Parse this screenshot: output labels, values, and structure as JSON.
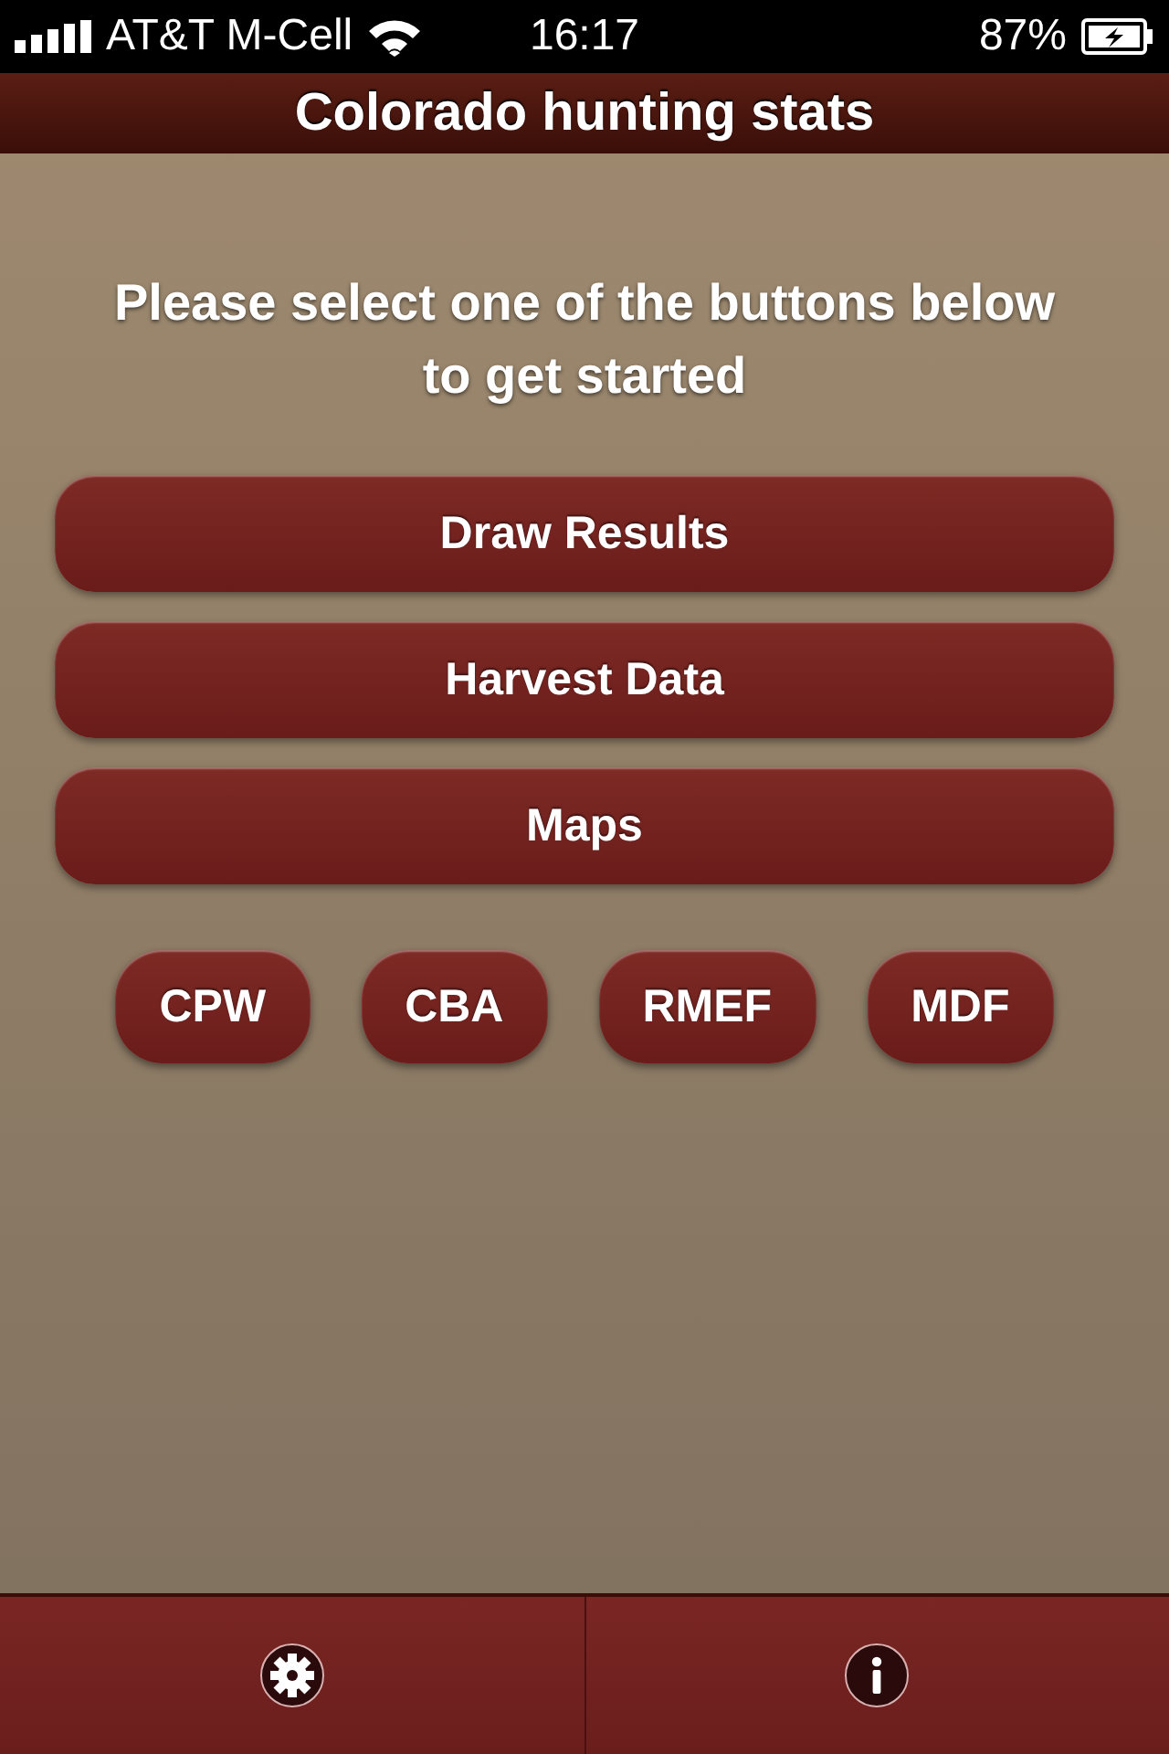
{
  "status_bar": {
    "carrier": "AT&T M-Cell",
    "time": "16:17",
    "battery": "87%"
  },
  "title": "Colorado hunting stats",
  "prompt": "Please select one of the buttons below to get started",
  "main_buttons": [
    "Draw Results",
    "Harvest Data",
    "Maps"
  ],
  "link_buttons": [
    "CPW",
    "CBA",
    "RMEF",
    "MDF"
  ],
  "tab_bar": [
    {
      "kind": "settings"
    },
    {
      "kind": "info"
    }
  ]
}
